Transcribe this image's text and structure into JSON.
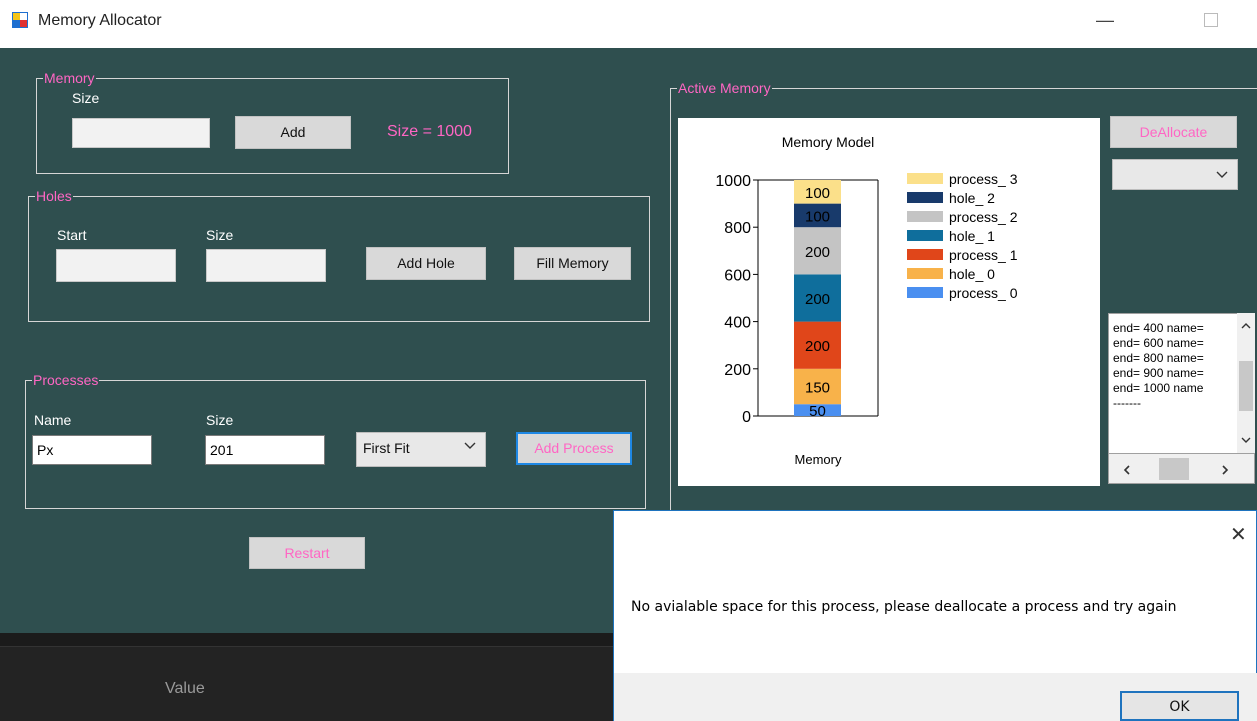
{
  "window": {
    "title": "Memory Allocator",
    "minimize": "—"
  },
  "memory_group": {
    "legend": "Memory",
    "size_label": "Size",
    "size_value": "",
    "add_button": "Add",
    "size_display": "Size = 1000"
  },
  "holes_group": {
    "legend": "Holes",
    "start_label": "Start",
    "size_label": "Size",
    "start_value": "",
    "size_value": "",
    "add_hole_button": "Add Hole",
    "fill_memory_button": "Fill Memory"
  },
  "processes_group": {
    "legend": "Processes",
    "name_label": "Name",
    "size_label": "Size",
    "name_value": "Px",
    "size_value": "201",
    "algorithm": "First Fit",
    "add_process_button": "Add Process"
  },
  "restart_button": "Restart",
  "active_memory": {
    "legend": "Active Memory",
    "deallocate_button": "DeAllocate",
    "deallocate_select": ""
  },
  "log_lines": [
    "end= 400 name=",
    "end= 600 name=",
    "end= 800 name=",
    "end= 900 name=",
    "end= 1000 name",
    "-------"
  ],
  "icons": {
    "app": "app-icon",
    "chevron": "chevron-down-icon",
    "scroll_up": "chevron-up-icon",
    "scroll_down": "chevron-down-icon",
    "scroll_left": "chevron-left-icon",
    "scroll_right": "chevron-right-icon",
    "close": "close-icon"
  },
  "bottom_grid": {
    "value_header": "Value"
  },
  "dialog": {
    "message": "No avialable space for this process, please deallocate a process and try again",
    "ok_button": "OK",
    "close_glyph": "✕"
  },
  "colors": {
    "accent": "#ff66c4",
    "client_bg": "#2f4f4f"
  },
  "chart_data": {
    "type": "bar",
    "stacked": true,
    "title": "Memory Model",
    "xlabel": "Memory",
    "ylabel": "",
    "ylim": [
      0,
      1000
    ],
    "yticks": [
      0,
      200,
      400,
      600,
      800,
      1000
    ],
    "categories": [
      "Memory"
    ],
    "legend_position": "right",
    "series": [
      {
        "name": "process_ 0",
        "values": [
          50
        ],
        "color": "#4a8ff0"
      },
      {
        "name": "hole_ 0",
        "values": [
          150
        ],
        "color": "#f8b24a"
      },
      {
        "name": "process_ 1",
        "values": [
          200
        ],
        "color": "#e0461a"
      },
      {
        "name": "hole_ 1",
        "values": [
          200
        ],
        "color": "#0f6e9c"
      },
      {
        "name": "process_ 2",
        "values": [
          200
        ],
        "color": "#c4c4c4"
      },
      {
        "name": "hole_ 2",
        "values": [
          100
        ],
        "color": "#183a6b"
      },
      {
        "name": "process_ 3",
        "values": [
          100
        ],
        "color": "#fbe08a"
      }
    ]
  }
}
